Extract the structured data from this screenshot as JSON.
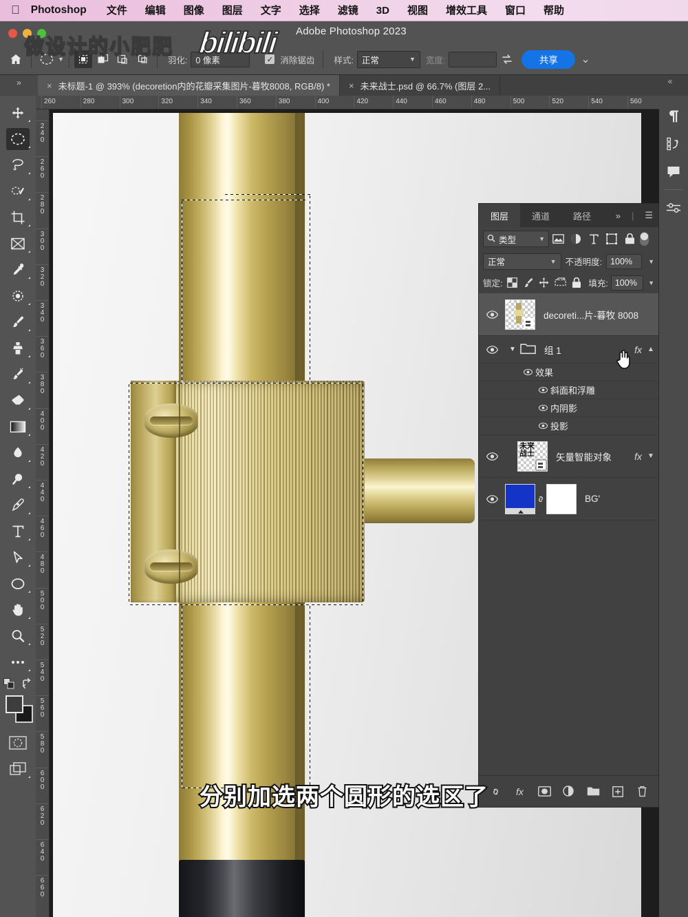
{
  "menubar": {
    "apple_icon": "apple-icon",
    "app_name": "Photoshop",
    "items": [
      "文件",
      "编辑",
      "图像",
      "图层",
      "文字",
      "选择",
      "滤镜",
      "3D",
      "视图",
      "增效工具",
      "窗口",
      "帮助"
    ]
  },
  "titlebar": {
    "app_title": "Adobe Photoshop 2023"
  },
  "watermark": {
    "text": "做设计的小肥肥",
    "brand": "bilibili"
  },
  "subtitle": {
    "text": "分别加选两个圆形的选区了"
  },
  "options_bar": {
    "home_icon": "home-icon",
    "tool_icon": "marquee-ellipse-icon",
    "tool_preset_chevron": "chevron-down-icon",
    "selection_modes": [
      "new-selection",
      "add-to-selection",
      "subtract-from-selection",
      "intersect-selection"
    ],
    "active_selection_mode": "new-selection",
    "feather_label": "羽化:",
    "feather_value": "0 像素",
    "antialias_label": "消除锯齿",
    "antialias_checked": true,
    "style_label": "样式:",
    "style_value": "正常",
    "width_label": "宽度:",
    "width_value": "",
    "swap_icon": "swap-arrows-icon",
    "share_label": "共享"
  },
  "tabbar": {
    "collapse_icon": "chevrons-right-icon",
    "expand_icon": "chevrons-left-icon",
    "tabs": [
      {
        "close": "×",
        "label": "未标题-1 @ 393% (decoretion内的花瓣采集图片-暮牧8008, RGB/8) *",
        "active": true
      },
      {
        "close": "×",
        "label": "未来战士.psd @ 66.7% (图层 2...",
        "active": false
      }
    ]
  },
  "toolbar": {
    "tools": [
      {
        "name": "move-tool",
        "icon": "move-icon",
        "selected": false
      },
      {
        "name": "elliptical-marquee-tool",
        "icon": "ellipse-marquee-icon",
        "selected": true
      },
      {
        "name": "lasso-tool",
        "icon": "lasso-icon",
        "selected": false
      },
      {
        "name": "object-selection-tool",
        "icon": "quick-selection-icon",
        "selected": false
      },
      {
        "name": "crop-tool",
        "icon": "crop-icon",
        "selected": false
      },
      {
        "name": "frame-tool",
        "icon": "frame-icon",
        "selected": false
      },
      {
        "name": "eyedropper-tool",
        "icon": "eyedropper-icon",
        "selected": false
      },
      {
        "name": "spot-healing-tool",
        "icon": "healing-brush-icon",
        "selected": false
      },
      {
        "name": "brush-tool",
        "icon": "brush-icon",
        "selected": false
      },
      {
        "name": "clone-stamp-tool",
        "icon": "clone-stamp-icon",
        "selected": false
      },
      {
        "name": "history-brush-tool",
        "icon": "history-brush-icon",
        "selected": false
      },
      {
        "name": "eraser-tool",
        "icon": "eraser-icon",
        "selected": false
      },
      {
        "name": "gradient-tool",
        "icon": "gradient-icon",
        "selected": false
      },
      {
        "name": "blur-tool",
        "icon": "blur-drop-icon",
        "selected": false
      },
      {
        "name": "dodge-tool",
        "icon": "dodge-icon",
        "selected": false
      },
      {
        "name": "pen-tool",
        "icon": "pen-icon",
        "selected": false
      },
      {
        "name": "type-tool",
        "icon": "type-icon",
        "selected": false
      },
      {
        "name": "path-selection-tool",
        "icon": "path-arrow-icon",
        "selected": false
      },
      {
        "name": "ellipse-shape-tool",
        "icon": "ellipse-shape-icon",
        "selected": false
      },
      {
        "name": "hand-tool",
        "icon": "hand-icon",
        "selected": false
      },
      {
        "name": "zoom-tool",
        "icon": "zoom-icon",
        "selected": false
      },
      {
        "name": "edit-toolbar",
        "icon": "ellipsis-icon",
        "selected": false
      }
    ],
    "foreground_color": "#3d3d3d",
    "background_color": "#1a1a1a",
    "default_colors_icon": "default-colors-icon",
    "swap_colors_icon": "swap-colors-icon",
    "quickmask_icon": "quick-mask-icon",
    "screenmode_icon": "screen-mode-icon"
  },
  "rulers": {
    "horizontal_ticks": [
      "260",
      "280",
      "300",
      "320",
      "340",
      "360",
      "380",
      "400",
      "420",
      "440",
      "460",
      "480",
      "500",
      "520",
      "540",
      "560"
    ],
    "vertical_ticks": [
      "240",
      "260",
      "280",
      "300",
      "320",
      "340",
      "360",
      "380",
      "400",
      "420",
      "440",
      "460",
      "480",
      "500",
      "520",
      "540",
      "560",
      "580",
      "600",
      "620",
      "640",
      "660"
    ],
    "unit_hint": "像素"
  },
  "right_dock": {
    "icons": [
      "paragraph-icon",
      "actions-icon",
      "comment-icon",
      "adjustments-icon"
    ]
  },
  "layers_panel": {
    "tabs": [
      {
        "label": "图层",
        "active": true
      },
      {
        "label": "通道",
        "active": false
      },
      {
        "label": "路径",
        "active": false
      }
    ],
    "overflow_icon": "chevrons-right-icon",
    "menu_icon": "hamburger-menu-icon",
    "filter": {
      "search_icon": "search-icon",
      "kind_label": "类型",
      "chevron": "chevron-down-icon",
      "filter_icons": [
        "pixel-filter-icon",
        "adjustment-filter-icon",
        "type-filter-icon",
        "shape-filter-icon",
        "smartobject-filter-icon"
      ],
      "toggle_on": true
    },
    "blend": {
      "mode_label": "正常",
      "opacity_label": "不透明度:",
      "opacity_value": "100%",
      "chevron": "chevron-down-icon"
    },
    "lock": {
      "label": "锁定:",
      "icons": [
        "lock-transparency-icon",
        "lock-image-icon",
        "lock-position-icon",
        "lock-artboard-icon",
        "lock-all-icon"
      ],
      "fill_label": "填充:",
      "fill_value": "100%"
    },
    "layers": [
      {
        "type": "layer",
        "name": "decoreti...片-暮牧 8008",
        "visible": true,
        "selected": true,
        "thumb": "transparent-smartobject",
        "fx": null
      },
      {
        "type": "group",
        "name": "组 1",
        "visible": true,
        "selected": false,
        "expanded": true,
        "fx": "fx",
        "expand_chevron": "chevron-up-icon",
        "effects_label": "效果",
        "effects": [
          "斜面和浮雕",
          "内阴影",
          "投影"
        ]
      },
      {
        "type": "layer",
        "name": "矢量智能对象",
        "visible": true,
        "selected": false,
        "thumb": "text-vector",
        "thumb_text": "未来战士",
        "fx": "fx",
        "expand_chevron": "chevron-down-icon"
      },
      {
        "type": "layer",
        "name": "BG'",
        "visible": true,
        "selected": false,
        "thumb": "blue-fill",
        "mask": "white-mask",
        "link_icon": "link-icon",
        "fx": null
      }
    ],
    "bottom_icons": [
      "link-layers-icon",
      "add-layer-style-icon",
      "add-layer-mask-icon",
      "new-adjustment-layer-icon",
      "new-group-icon",
      "new-layer-icon",
      "delete-layer-icon"
    ],
    "bottom_fx_label": "fx"
  },
  "canvas": {
    "document_title": "未标题-1",
    "zoom": "393%",
    "selection_active": true,
    "cursor_icon": "hand-pointer-icon"
  },
  "colors": {
    "menubar_bg": "#eec5e2",
    "chrome_bg": "#535353",
    "panel_bg": "#414141",
    "accent_blue": "#1473e6",
    "selected_row": "#565656"
  }
}
